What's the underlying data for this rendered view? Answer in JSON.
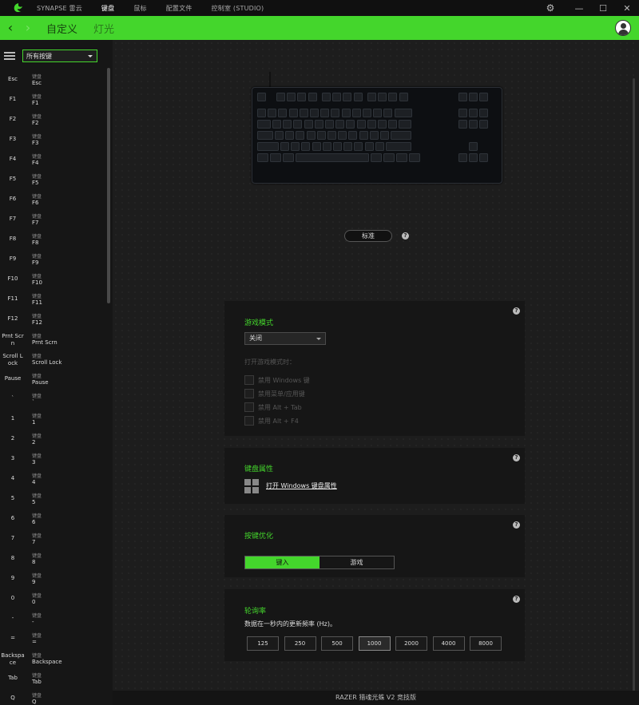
{
  "titlebar": {
    "tabs": [
      "SYNAPSE 雷云",
      "键盘",
      "鼠标",
      "配置文件",
      "控制室 (STUDIO)"
    ],
    "active_tab": "键盘"
  },
  "header": {
    "title": "自定义",
    "subtitle": "灯光"
  },
  "sidebar": {
    "filter": "所有按键",
    "keys": [
      {
        "name": "Esc",
        "cat": "键盘",
        "val": "Esc"
      },
      {
        "name": "F1",
        "cat": "键盘",
        "val": "F1"
      },
      {
        "name": "F2",
        "cat": "键盘",
        "val": "F2"
      },
      {
        "name": "F3",
        "cat": "键盘",
        "val": "F3"
      },
      {
        "name": "F4",
        "cat": "键盘",
        "val": "F4"
      },
      {
        "name": "F5",
        "cat": "键盘",
        "val": "F5"
      },
      {
        "name": "F6",
        "cat": "键盘",
        "val": "F6"
      },
      {
        "name": "F7",
        "cat": "键盘",
        "val": "F7"
      },
      {
        "name": "F8",
        "cat": "键盘",
        "val": "F8"
      },
      {
        "name": "F9",
        "cat": "键盘",
        "val": "F9"
      },
      {
        "name": "F10",
        "cat": "键盘",
        "val": "F10"
      },
      {
        "name": "F11",
        "cat": "键盘",
        "val": "F11"
      },
      {
        "name": "F12",
        "cat": "键盘",
        "val": "F12"
      },
      {
        "name": "Prnt Scrn",
        "cat": "键盘",
        "val": "Prnt Scrn"
      },
      {
        "name": "Scroll Lock",
        "cat": "键盘",
        "val": "Scroll Lock"
      },
      {
        "name": "Pause",
        "cat": "键盘",
        "val": "Pause"
      },
      {
        "name": "`",
        "cat": "键盘",
        "val": "`"
      },
      {
        "name": "1",
        "cat": "键盘",
        "val": "1"
      },
      {
        "name": "2",
        "cat": "键盘",
        "val": "2"
      },
      {
        "name": "3",
        "cat": "键盘",
        "val": "3"
      },
      {
        "name": "4",
        "cat": "键盘",
        "val": "4"
      },
      {
        "name": "5",
        "cat": "键盘",
        "val": "5"
      },
      {
        "name": "6",
        "cat": "键盘",
        "val": "6"
      },
      {
        "name": "7",
        "cat": "键盘",
        "val": "7"
      },
      {
        "name": "8",
        "cat": "键盘",
        "val": "8"
      },
      {
        "name": "9",
        "cat": "键盘",
        "val": "9"
      },
      {
        "name": "0",
        "cat": "键盘",
        "val": "0"
      },
      {
        "name": "-",
        "cat": "键盘",
        "val": "-"
      },
      {
        "name": "=",
        "cat": "键盘",
        "val": "="
      },
      {
        "name": "Backspace",
        "cat": "键盘",
        "val": "Backspace"
      },
      {
        "name": "Tab",
        "cat": "键盘",
        "val": "Tab"
      },
      {
        "name": "Q",
        "cat": "键盘",
        "val": "Q"
      }
    ]
  },
  "profile_button": "标准",
  "game_mode": {
    "title": "游戏模式",
    "value": "关闭",
    "subtitle": "打开游戏模式时：",
    "options": [
      "禁用 Windows 键",
      "禁用菜单/应用键",
      "禁用 Alt + Tab",
      "禁用 Alt + F4"
    ]
  },
  "keyboard_props": {
    "title": "键盘属性",
    "link": "打开 Windows 键盘属性"
  },
  "key_opt": {
    "title": "按键优化",
    "options": [
      "键入",
      "游戏"
    ],
    "selected": "键入"
  },
  "polling": {
    "title": "轮询率",
    "desc": "数据在一秒内的更新频率 (Hz)。",
    "rates": [
      "125",
      "250",
      "500",
      "1000",
      "2000",
      "4000",
      "8000"
    ],
    "selected": "1000"
  },
  "device_name": "RAZER 猎魂光蛛 V2 竞技版",
  "colors": {
    "accent": "#44d62c"
  }
}
